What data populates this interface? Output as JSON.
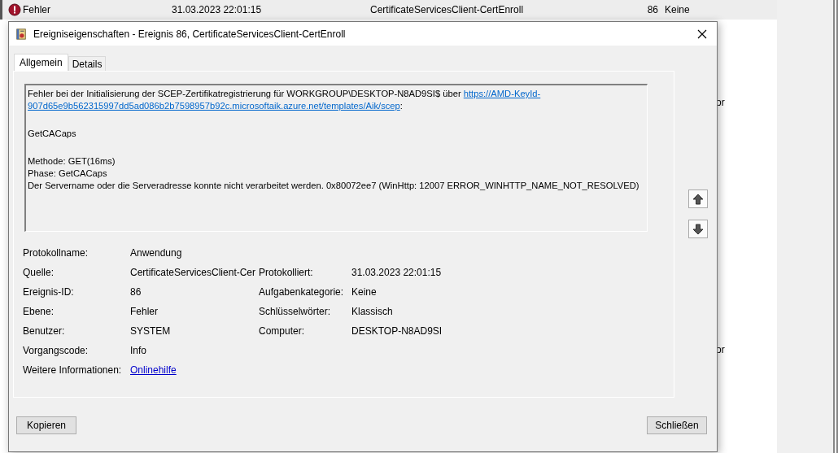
{
  "background_list": {
    "rows": [
      {
        "kind": "error",
        "level": "Fehler",
        "date": "31.03.2023 22:01:15",
        "source": "CertificateServicesClient-CertEnroll",
        "event_id": "86",
        "category": "Keine",
        "selected": true
      }
    ],
    "peeking_texts": [
      "or",
      "or"
    ]
  },
  "dialog": {
    "title": "Ereigniseigenschaften - Ereignis 86, CertificateServicesClient-CertEnroll",
    "tabs": [
      {
        "label": "Allgemein",
        "selected": true
      },
      {
        "label": "Details",
        "selected": false
      }
    ],
    "message": {
      "lines": [
        {
          "text": "Fehler bei der Initialisierung der SCEP-Zertifikatregistrierung für WORKGROUP\\DESKTOP-N8AD9SI$ über ",
          "link": "https://AMD-KeyId-"
        },
        {
          "link": "907d65e9b562315997dd5ad086b2b7598957b92c.microsoftaik.azure.net/templates/Aik/scep",
          "after": ":"
        },
        {
          "kind": "blank"
        },
        {
          "text": "GetCACaps"
        },
        {
          "kind": "blank"
        },
        {
          "text": "Methode: GET(16ms)"
        },
        {
          "text": "Phase: GetCACaps"
        },
        {
          "text": "Der Servername oder die Serveradresse konnte nicht verarbeitet werden. 0x80072ee7 (WinHttp: 12007 ERROR_WINHTTP_NAME_NOT_RESOLVED)"
        }
      ]
    },
    "fields": [
      {
        "left": {
          "label": "Protokollname:",
          "value": "Anwendung",
          "kind": "text"
        }
      },
      {
        "left": {
          "label": "Quelle:",
          "value": "CertificateServicesClient-Cer",
          "kind": "text"
        },
        "right": {
          "label": "Protokolliert:",
          "value": "31.03.2023 22:01:15"
        }
      },
      {
        "left": {
          "label": "Ereignis-ID:",
          "value": "86",
          "kind": "text"
        },
        "right": {
          "label": "Aufgabenkategorie:",
          "value": "Keine"
        }
      },
      {
        "left": {
          "label": "Ebene:",
          "value": "Fehler",
          "kind": "text"
        },
        "right": {
          "label": "Schlüsselwörter:",
          "value": "Klassisch"
        }
      },
      {
        "left": {
          "label": "Benutzer:",
          "value": "SYSTEM",
          "kind": "text"
        },
        "right": {
          "label": "Computer:",
          "value": "DESKTOP-N8AD9SI"
        }
      },
      {
        "left": {
          "label": "Vorgangscode:",
          "value": "Info",
          "kind": "text"
        }
      },
      {
        "left": {
          "label": "Weitere Informationen:",
          "value": "Onlinehilfe",
          "kind": "link"
        }
      }
    ],
    "copy_button": "Kopieren",
    "close_button": "Schließen"
  }
}
